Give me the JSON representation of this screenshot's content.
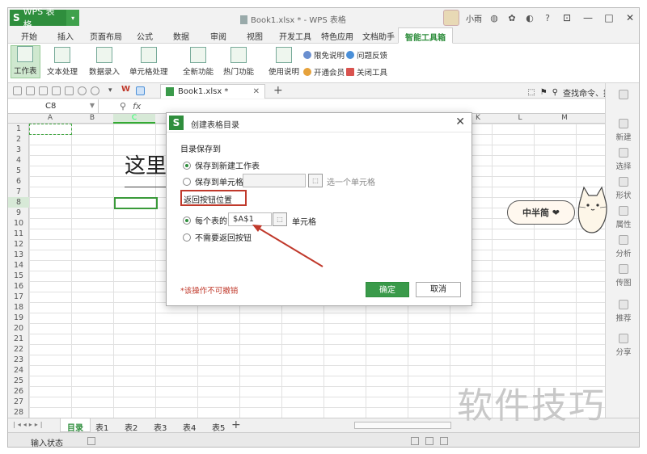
{
  "title_bar": {
    "app_name": "WPS 表格",
    "document_title": "Book1.xlsx * - WPS 表格",
    "user_name": "小雨",
    "help": "?"
  },
  "menu_tabs": [
    "开始",
    "插入",
    "页面布局",
    "公式",
    "数据",
    "审阅",
    "视图",
    "开发工具",
    "特色应用",
    "文档助手",
    "智能工具箱"
  ],
  "active_menu_tab": "智能工具箱",
  "ribbon": {
    "buttons": [
      "工作表",
      "文本处理",
      "数据录入",
      "单元格处理",
      "全新功能",
      "热门功能",
      "使用说明"
    ],
    "small_links": [
      "限免说明",
      "问题反馈",
      "开通会员",
      "关闭工具"
    ]
  },
  "quick_bar": {
    "doc_tab": "Book1.xlsx *",
    "search_label": "查找命令、搜索模板"
  },
  "formula_bar": {
    "name_box": "C8",
    "fx": "fx"
  },
  "columns": [
    "A",
    "B",
    "C",
    "D",
    "E",
    "F",
    "G",
    "H",
    "I",
    "J",
    "K",
    "L",
    "M"
  ],
  "rows": [
    "1",
    "2",
    "3",
    "4",
    "5",
    "6",
    "7",
    "8",
    "9",
    "10",
    "11",
    "12",
    "13",
    "14",
    "15",
    "16",
    "17",
    "18",
    "19",
    "20",
    "21",
    "22",
    "23",
    "24",
    "25",
    "26",
    "27",
    "28"
  ],
  "cell_text": "这里",
  "right_panel": [
    "新建",
    "选择",
    "形状",
    "属性",
    "分析",
    "传图",
    "推荐",
    "分享"
  ],
  "sheets": [
    "目录",
    "表1",
    "表2",
    "表3",
    "表4",
    "表5"
  ],
  "active_sheet": "目录",
  "status": "输入状态",
  "dialog": {
    "title": "创建表格目录",
    "section_save": "目录保存到",
    "opt_new_sheet": "保存到新建工作表",
    "opt_cell": "保存到单元格",
    "cell_hint": "选一个单元格",
    "section_back": "返回按钮位置",
    "opt_each_sheet": "每个表的",
    "back_cell_value": "$A$1",
    "cell_suffix": "单元格",
    "opt_no_back": "不需要返回按钮",
    "warning": "*该操作不可撤销",
    "ok": "确定",
    "cancel": "取消"
  },
  "sticker_text": "中半简 ❤",
  "watermark": "软件技巧",
  "colors": {
    "brand_green": "#2f8e3d",
    "highlight_red": "#c0392b"
  }
}
